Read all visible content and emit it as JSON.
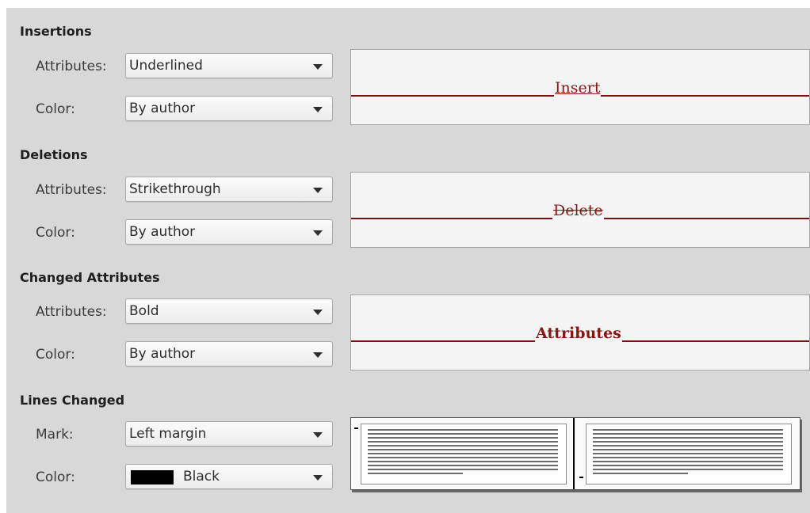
{
  "sections": {
    "insertions": {
      "title": "Insertions",
      "attributes_label": "Attributes:",
      "attributes_value": "Underlined",
      "color_label": "Color:",
      "color_value": "By author",
      "preview_text": "Insert"
    },
    "deletions": {
      "title": "Deletions",
      "attributes_label": "Attributes:",
      "attributes_value": "Strikethrough",
      "color_label": "Color:",
      "color_value": "By author",
      "preview_text": "Delete"
    },
    "changed": {
      "title": "Changed Attributes",
      "attributes_label": "Attributes:",
      "attributes_value": "Bold",
      "color_label": "Color:",
      "color_value": "By author",
      "preview_text": "Attributes"
    },
    "lines": {
      "title": "Lines Changed",
      "mark_label": "Mark:",
      "mark_value": "Left margin",
      "color_label": "Color:",
      "color_value": "Black",
      "color_swatch": "#000000"
    }
  },
  "colors": {
    "panel_bg": "#d8d8d8",
    "preview_line": "#7b1010",
    "preview_text": "#8a1515"
  }
}
